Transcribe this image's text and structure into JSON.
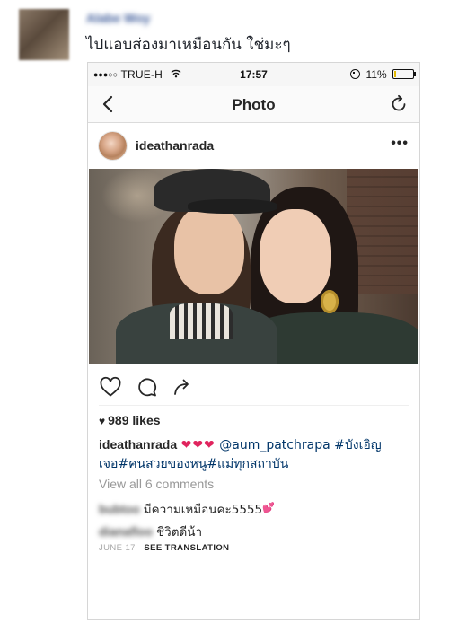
{
  "facebook_post": {
    "author_name": "Alabe Woy",
    "caption": "ไปแอบส่องมาเหมือนกัน ใช่มะๆ"
  },
  "status_bar": {
    "carrier_dots": "●●●○○",
    "carrier": "TRUE-H",
    "time": "17:57",
    "battery_percent": "11%",
    "battery_level": 0.11,
    "battery_color": "#e2b800"
  },
  "nav_bar": {
    "back_icon": "chevron-left",
    "title": "Photo",
    "refresh_icon": "refresh"
  },
  "post": {
    "username": "ideathanrada",
    "more_icon": "•••",
    "actions": [
      "heart-icon",
      "comment-icon",
      "share-icon"
    ],
    "likes_icon": "♥",
    "likes": "989 likes",
    "caption_user": "ideathanrada",
    "caption_emojis": "❤❤❤",
    "caption_mention": "@aum_patchrapa",
    "caption_tags": "#บังเอิญเจอ#คนสวยของหนู#แม่ทุกสถาบัน",
    "view_all_comments": "View all 6 comments",
    "comments": [
      {
        "user": "bubtoo",
        "text": "มีความเหมือนคะ5555",
        "emoji": "💕"
      },
      {
        "user": "dianafloo",
        "text": "ชีวิตดีน้า"
      }
    ],
    "date": "JUNE 17",
    "separator": "·",
    "see_translation": "SEE TRANSLATION",
    "link_color": "#003569"
  }
}
